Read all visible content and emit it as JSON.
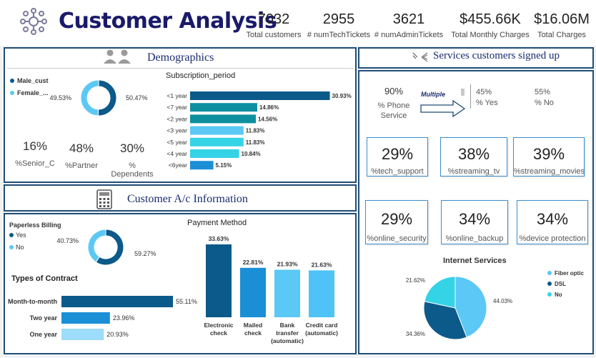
{
  "header": {
    "title": "Customer Analysis",
    "kpis": [
      {
        "value": "7032",
        "label": "Total customers"
      },
      {
        "value": "2955",
        "label": "# numTechTickets"
      },
      {
        "value": "3621",
        "label": "# numAdminTickets"
      },
      {
        "value": "$455.66K",
        "label": "Total Monthly Charges"
      },
      {
        "value": "$16.06M",
        "label": "Total Charges"
      }
    ]
  },
  "demographics": {
    "title": "Demographics",
    "stats": [
      {
        "value": "16%",
        "label": "%Senior_C"
      },
      {
        "value": "48%",
        "label": "%Partner"
      },
      {
        "value": "30%",
        "label": "% Dependents"
      }
    ]
  },
  "account": {
    "title": "Customer A/c Information"
  },
  "services": {
    "title": "Services customers signed up",
    "phone": {
      "value": "90%",
      "label": "% Phone Service",
      "multiple_label": "Multiple",
      "yes_value": "45%",
      "yes_label": "% Yes",
      "no_value": "55%",
      "no_label": "% No"
    },
    "cards": [
      {
        "value": "29%",
        "label": "%tech_support"
      },
      {
        "value": "38%",
        "label": "%streaming_tv"
      },
      {
        "value": "39%",
        "label": "%streaming_movies"
      },
      {
        "value": "29%",
        "label": "%online_security"
      },
      {
        "value": "34%",
        "label": "%online_backup"
      },
      {
        "value": "34%",
        "label": "%device protection"
      }
    ]
  },
  "colors": {
    "navy": "#1f4e79",
    "dark_blue": "#0b5a8a",
    "teal": "#0e8fa0",
    "mid_blue": "#1a8fd6",
    "light_blue": "#5bc8f5",
    "cyan": "#35d3e6",
    "sky": "#9ddcfa"
  },
  "chart_data": [
    {
      "type": "pie",
      "style": "donut",
      "categories": [
        "Male_cust",
        "Female_..."
      ],
      "values": [
        50.47,
        49.53
      ],
      "data_labels": [
        "50.47%",
        "49.53%"
      ]
    },
    {
      "type": "bar",
      "orientation": "horizontal",
      "title": "Subscription_period",
      "categories": [
        "<1 year",
        "<7 year",
        "<2 year",
        "<3 year",
        "<5 year",
        "<4 year",
        "<6year"
      ],
      "values": [
        30.93,
        14.86,
        14.56,
        11.83,
        11.83,
        10.84,
        5.15
      ],
      "data_labels": [
        "30.93%",
        "14.86%",
        "14.56%",
        "11.83%",
        "11.83%",
        "10.84%",
        "5.15%"
      ]
    },
    {
      "type": "pie",
      "style": "donut",
      "title": "Paperless Billing",
      "categories": [
        "Yes",
        "No"
      ],
      "values": [
        59.27,
        40.73
      ],
      "data_labels": [
        "59.27%",
        "40.73%"
      ]
    },
    {
      "type": "bar",
      "orientation": "horizontal",
      "title": "Types of Contract",
      "categories": [
        "Month-to-month",
        "Two year",
        "One year"
      ],
      "values": [
        55.11,
        23.96,
        20.93
      ],
      "data_labels": [
        "55.11%",
        "23.96%",
        "20.93%"
      ]
    },
    {
      "type": "bar",
      "orientation": "vertical",
      "title": "Payment Method",
      "categories": [
        [
          "Electronic",
          "check"
        ],
        [
          "Mailed",
          "check"
        ],
        [
          "Bank",
          "transfer",
          "(automatic)"
        ],
        [
          "Credit card",
          "(automatic)"
        ]
      ],
      "values": [
        33.63,
        22.81,
        21.93,
        21.63
      ],
      "data_labels": [
        "33.63%",
        "22.81%",
        "21.93%",
        "21.63%"
      ]
    },
    {
      "type": "pie",
      "title": "Internet Services",
      "categories": [
        "Fiber optic",
        "DSL",
        "No"
      ],
      "values": [
        44.03,
        34.36,
        21.62
      ],
      "data_labels": [
        "44.03%",
        "34.36%",
        "21.62%"
      ],
      "legend": "right"
    }
  ]
}
